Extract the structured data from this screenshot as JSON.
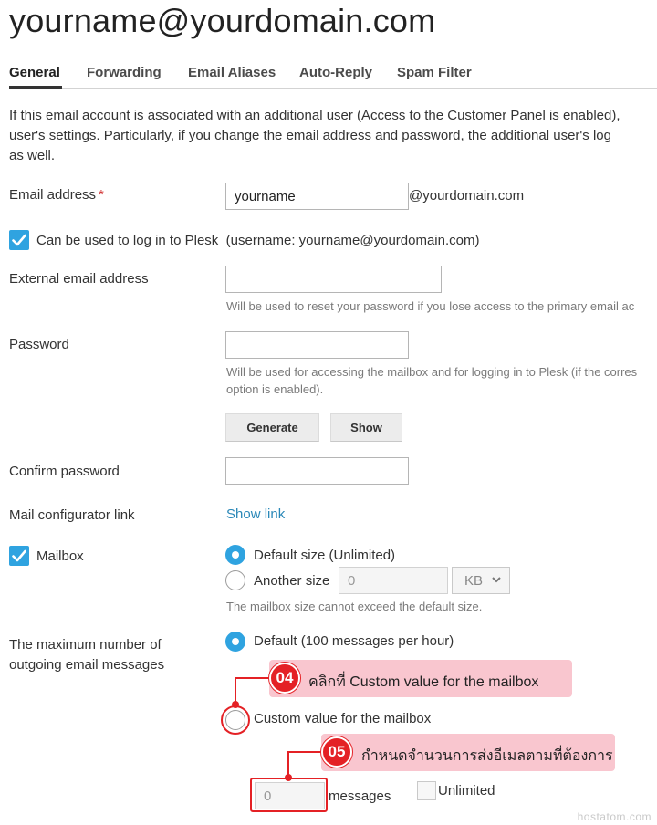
{
  "page": {
    "title": "yourname@yourdomain.com"
  },
  "tabs": [
    {
      "label": "General",
      "active": true
    },
    {
      "label": "Forwarding"
    },
    {
      "label": "Email Aliases"
    },
    {
      "label": "Auto-Reply"
    },
    {
      "label": "Spam Filter"
    }
  ],
  "intro": {
    "line1": "If this email account is associated with an additional user (Access to the Customer Panel is enabled),",
    "line2": "user's settings. Particularly, if you change the email address and password, the additional user's log",
    "line3": "as well."
  },
  "email": {
    "label": "Email address",
    "required_mark": "*",
    "value": "yourname",
    "domain": "@yourdomain.com"
  },
  "plesk_login": {
    "label": "Can be used to log in to Plesk",
    "note": "(username: yourname@yourdomain.com)",
    "checked": true
  },
  "external_email": {
    "label": "External email address",
    "value": "",
    "hint": "Will be used to reset your password if you lose access to the primary email ac"
  },
  "password": {
    "label": "Password",
    "value": "",
    "hint_line1": "Will be used for accessing the mailbox and for logging in to Plesk (if the corres",
    "hint_line2": "option is enabled).",
    "generate_label": "Generate",
    "show_label": "Show"
  },
  "confirm_password": {
    "label": "Confirm password",
    "value": ""
  },
  "mail_configurator": {
    "label": "Mail configurator link",
    "link_text": "Show link"
  },
  "mailbox": {
    "label": "Mailbox",
    "checked": true,
    "default_size_label": "Default size (Unlimited)",
    "another_size_label": "Another size",
    "size_value": "0",
    "unit": "KB",
    "hint": "The mailbox size cannot exceed the default size."
  },
  "outgoing": {
    "label_line1": "The maximum number of",
    "label_line2": "outgoing email messages",
    "default_label": "Default (100 messages per hour)",
    "custom_label": "Custom value for the mailbox",
    "messages_value": "0",
    "messages_label": "messages",
    "unlimited_label": "Unlimited"
  },
  "annotations": {
    "step4": {
      "number": "04",
      "text": "คลิกที่ Custom value for the mailbox"
    },
    "step5": {
      "number": "05",
      "text": "กำหนดจำนวนการส่งอีเมลตามที่ต้องการ"
    }
  },
  "watermark": "hostatom.com",
  "colors": {
    "accent": "#2fa3e0",
    "link": "#2a88b8",
    "annotation_red": "#e42125",
    "annotation_bg": "#f9c6cf"
  },
  "icons": {
    "checkbox": "check-icon",
    "select": "chevron-down-icon"
  }
}
